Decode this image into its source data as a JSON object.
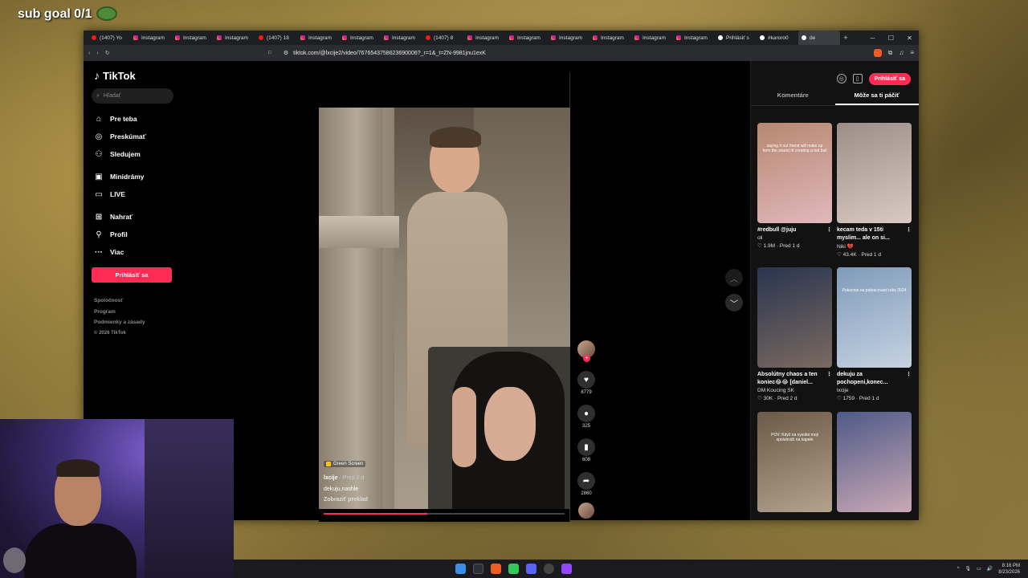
{
  "overlay": {
    "sub_goal": "sub goal 0/1"
  },
  "browser": {
    "tabs": [
      {
        "label": "(1407) Yo",
        "type": "yt"
      },
      {
        "label": "Instagram",
        "type": "ig"
      },
      {
        "label": "Instagram",
        "type": "ig"
      },
      {
        "label": "Instagram",
        "type": "ig"
      },
      {
        "label": "(1407) 18",
        "type": "yt"
      },
      {
        "label": "Instagram",
        "type": "ig"
      },
      {
        "label": "Instagram",
        "type": "ig"
      },
      {
        "label": "Instagram",
        "type": "ig"
      },
      {
        "label": "(1407) 8",
        "type": "yt"
      },
      {
        "label": "Instagram",
        "type": "ig"
      },
      {
        "label": "Instagram",
        "type": "ig"
      },
      {
        "label": "Instagram",
        "type": "ig"
      },
      {
        "label": "Instagram",
        "type": "ig"
      },
      {
        "label": "Instagram",
        "type": "ig"
      },
      {
        "label": "Instagram",
        "type": "ig"
      },
      {
        "label": "Prihlásiť s",
        "type": "tt"
      },
      {
        "label": "#karoro0",
        "type": "tt"
      },
      {
        "label": "de",
        "type": "tt",
        "active": true
      }
    ],
    "url": "tiktok.com/@lxcije2/video/7676543758623690006?_r=1&_t=ZN-9981jnu1exK"
  },
  "sidebar": {
    "logo": "TikTok",
    "search_placeholder": "Hľadať",
    "nav": [
      {
        "label": "Pre teba",
        "icon": "home-icon",
        "glyph": "⌂"
      },
      {
        "label": "Preskúmať",
        "icon": "compass-icon",
        "glyph": "◎"
      },
      {
        "label": "Sledujem",
        "icon": "following-icon",
        "glyph": "⚇"
      },
      {
        "label": "Minidrámy",
        "icon": "minidrama-icon",
        "glyph": "▣"
      },
      {
        "label": "LIVE",
        "icon": "live-icon",
        "glyph": "▭"
      },
      {
        "label": "Nahrať",
        "icon": "upload-icon",
        "glyph": "⊞"
      },
      {
        "label": "Profil",
        "icon": "profile-icon",
        "glyph": "⚲"
      },
      {
        "label": "Viac",
        "icon": "more-icon",
        "glyph": "···"
      }
    ],
    "login": "Prihlásiť sa",
    "footer": [
      "Spoločnosť",
      "Program",
      "Podmienky a zásady"
    ],
    "copyright": "© 2026 TikTok"
  },
  "video": {
    "badge": "Green Screen",
    "author": "lxcije",
    "date": "· Pred 2 d",
    "caption": "dekuju,nashle",
    "translate": "Zobraziť preklad",
    "progress": 0.43
  },
  "actions": {
    "likes": "8779",
    "comments": "325",
    "saves": "608",
    "shares": "2860"
  },
  "right_panel": {
    "login": "Prihlásiť sa",
    "tabs": [
      "Komentáre",
      "Môže sa ti páčiť"
    ],
    "cards": [
      {
        "title": "#redbull @juju",
        "author": "oli",
        "stats": "♡ 1.9M · Pred 1 d",
        "thumb_text": "saying if our friend will make up from the sound of creating a red bull",
        "c1": "#b6876f",
        "c2": "#e1b8bd"
      },
      {
        "title": "kecam teda v 15ti myslim... ale on si...",
        "author": "Niki 💔",
        "stats": "♡ 43.4K · Pred 1 d",
        "thumb_text": "",
        "c1": "#9c8e86",
        "c2": "#d9c9c2"
      },
      {
        "title": "Absolútny chaos a ten koniec😂😂 [daniel...",
        "author": "DM Koucing SK",
        "stats": "♡ 30K · Pred 2 d",
        "thumb_text": "",
        "c1": "#2a3550",
        "c2": "#7b6a61"
      },
      {
        "title": "dekuju za pochopeni,konec...",
        "author": "lxcije",
        "stats": "♡ 1759 · Pred 1 d",
        "thumb_text": "Pokecme na pokracovani roku 2024",
        "c1": "#7f9bb9",
        "c2": "#c6d2e2"
      },
      {
        "title": "",
        "author": "",
        "stats": "",
        "thumb_text": "POV: Když na vysoké moji spoluhráči na kapele",
        "c1": "#6c5a48",
        "c2": "#b3a38d"
      },
      {
        "title": "",
        "author": "",
        "stats": "",
        "thumb_text": "",
        "c1": "#4f5a88",
        "c2": "#c9a8b4"
      }
    ]
  },
  "taskbar": {
    "time": "8:16 PM",
    "date": "8/23/2026"
  }
}
